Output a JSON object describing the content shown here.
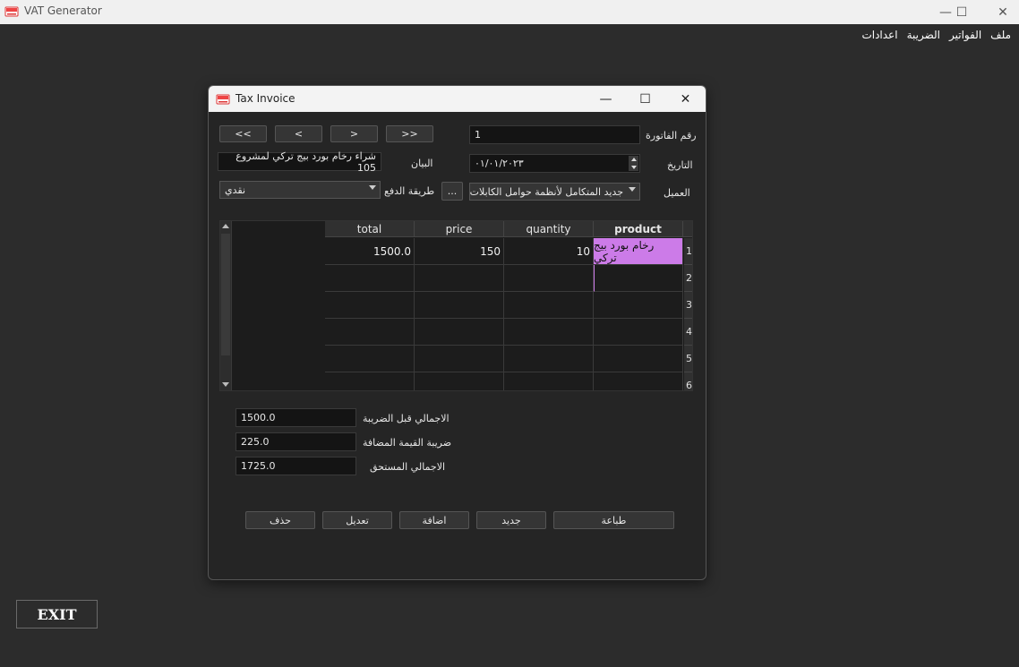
{
  "app": {
    "title": "VAT Generator",
    "window_controls": {
      "minimize": "—",
      "maximize": "☐",
      "close": "✕"
    }
  },
  "menubar": {
    "items": [
      "ملف",
      "الفواتير",
      "الضريبة",
      "اعدادات"
    ]
  },
  "dialog": {
    "title": "Tax Invoice",
    "nav": {
      "first": "<<",
      "prev": "<",
      "next": ">",
      "last": ">>"
    },
    "invoice_number_label": "رقم الفاتورة",
    "invoice_number": "1",
    "date_label": "التاريخ",
    "date": "٠١/٠١/٢٠٢٣",
    "statement_label": "البيان",
    "statement": "شراء رخام بورد بيج تركي لمشروع 105",
    "customer_label": "العميل",
    "customer": "جديد المتكامل لأنظمة حوامل الكابلات",
    "payment_label": "طريقة الدفع",
    "payment_method": "نقدي",
    "browse_label": "...",
    "table": {
      "columns": [
        "product",
        "quantity",
        "price",
        "total"
      ],
      "rows": [
        {
          "num": "1",
          "product": "رخام بورد بيج تركي",
          "quantity": "10",
          "price": "150",
          "total": "1500.0"
        },
        {
          "num": "2",
          "product": "",
          "quantity": "",
          "price": "",
          "total": ""
        },
        {
          "num": "3",
          "product": "",
          "quantity": "",
          "price": "",
          "total": ""
        },
        {
          "num": "4",
          "product": "",
          "quantity": "",
          "price": "",
          "total": ""
        },
        {
          "num": "5",
          "product": "",
          "quantity": "",
          "price": "",
          "total": ""
        },
        {
          "num": "6",
          "product": "",
          "quantity": "",
          "price": "",
          "total": ""
        }
      ]
    },
    "totals": {
      "before_tax_label": "الاجمالي قبل الضريبة",
      "before_tax": "1500.0",
      "vat_label": "ضريبة القيمة المضافة",
      "vat": "225.0",
      "due_label": "الاجمالي المستحق",
      "due": "1725.0"
    },
    "actions": {
      "delete": "حذف",
      "edit": "تعديل",
      "add": "اضافة",
      "new": "جديد",
      "print": "طباعة"
    }
  },
  "exit_label": "EXIT",
  "colors": {
    "selected_cell": "#cc7be8",
    "background": "#2c2c2c"
  }
}
